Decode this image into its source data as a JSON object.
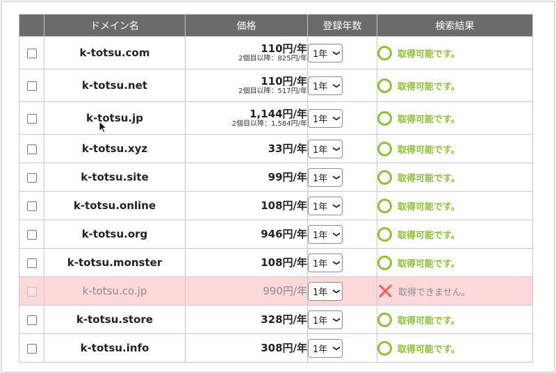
{
  "header": {
    "domain": "ドメイン名",
    "price": "価格",
    "years": "登録年数",
    "result": "検索結果"
  },
  "colors": {
    "ok": "#8bc232",
    "ng": "#f05d5d",
    "header_bg": "#6b6b6b",
    "unavailable_bg": "#ffd9d9"
  },
  "rows": [
    {
      "domain": "k-totsu.com",
      "price": "110円/年",
      "renewal": "2個目以降：825円/年",
      "years": "1年",
      "status": "取得可能です。",
      "available": true
    },
    {
      "domain": "k-totsu.net",
      "price": "110円/年",
      "renewal": "2個目以降：517円/年",
      "years": "1年",
      "status": "取得可能です。",
      "available": true
    },
    {
      "domain": "k-totsu.jp",
      "price": "1,144円/年",
      "renewal": "2個目以降：1,584円/年",
      "years": "1年",
      "status": "取得可能です。",
      "available": true
    },
    {
      "domain": "k-totsu.xyz",
      "price": "33円/年",
      "years": "1年",
      "status": "取得可能です。",
      "available": true
    },
    {
      "domain": "k-totsu.site",
      "price": "99円/年",
      "years": "1年",
      "status": "取得可能です。",
      "available": true
    },
    {
      "domain": "k-totsu.online",
      "price": "108円/年",
      "years": "1年",
      "status": "取得可能です。",
      "available": true
    },
    {
      "domain": "k-totsu.org",
      "price": "946円/年",
      "years": "1年",
      "status": "取得可能です。",
      "available": true
    },
    {
      "domain": "k-totsu.monster",
      "price": "108円/年",
      "years": "1年",
      "status": "取得可能です。",
      "available": true
    },
    {
      "domain": "k-totsu.co.jp",
      "price": "990円/年",
      "years": "1年",
      "status": "取得できません。",
      "available": false
    },
    {
      "domain": "k-totsu.store",
      "price": "328円/年",
      "years": "1年",
      "status": "取得可能です。",
      "available": true
    },
    {
      "domain": "k-totsu.info",
      "price": "308円/年",
      "years": "1年",
      "status": "取得可能です。",
      "available": true
    }
  ]
}
